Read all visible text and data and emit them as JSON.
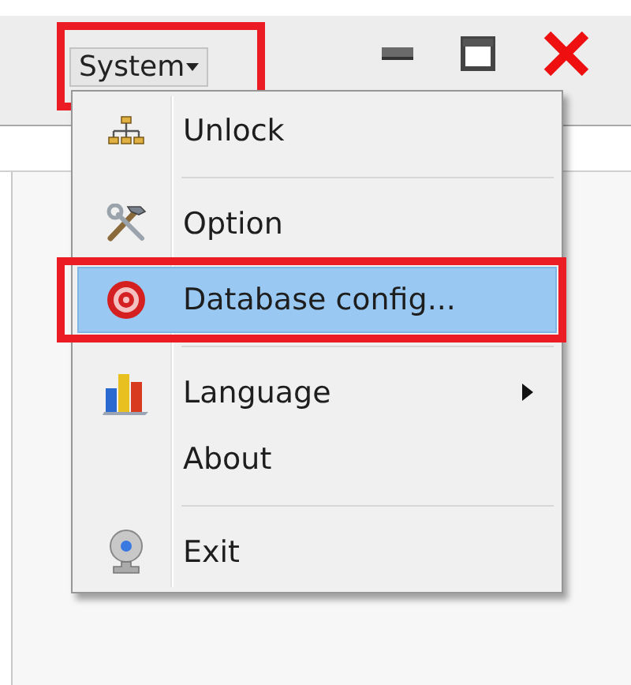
{
  "menu_button": {
    "label": "System",
    "annotated": true
  },
  "menu": {
    "items": [
      {
        "kind": "item",
        "label": "Unlock",
        "selected": false,
        "annotated": false,
        "submenu": false
      },
      {
        "kind": "separator"
      },
      {
        "kind": "item",
        "label": "Option",
        "selected": false,
        "annotated": false,
        "submenu": false
      },
      {
        "kind": "item",
        "label": "Database config...",
        "selected": true,
        "annotated": true,
        "submenu": false
      },
      {
        "kind": "separator"
      },
      {
        "kind": "item",
        "label": "Language",
        "selected": false,
        "annotated": false,
        "submenu": true
      },
      {
        "kind": "item",
        "label": "About",
        "selected": false,
        "annotated": false,
        "submenu": false
      },
      {
        "kind": "separator"
      },
      {
        "kind": "item",
        "label": "Exit",
        "selected": false,
        "annotated": false,
        "submenu": false
      }
    ]
  }
}
